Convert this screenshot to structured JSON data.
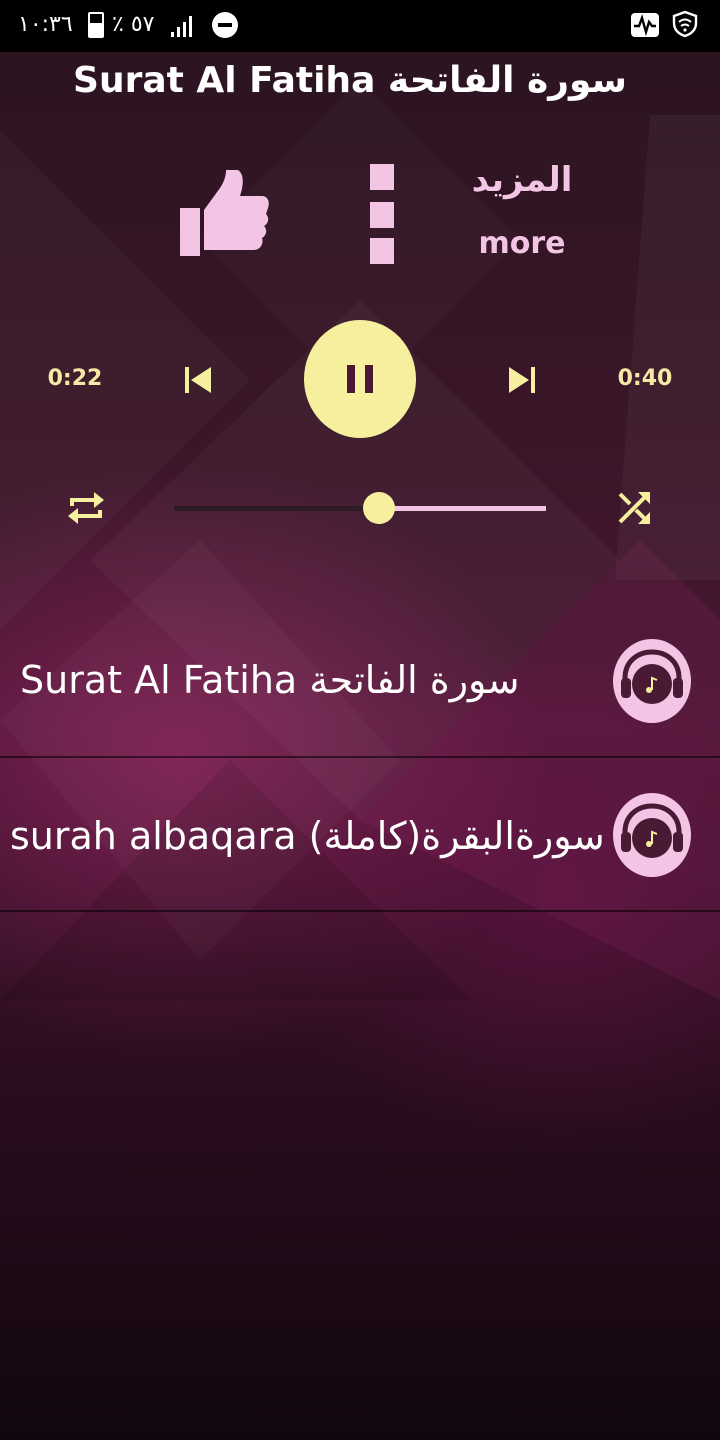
{
  "status_bar": {
    "time": "١٠:٣٦",
    "battery_percent": "٪ ٥٧",
    "battery_level": 0.57,
    "icons": [
      "battery-icon",
      "signal-icon",
      "do-not-disturb-icon",
      "activity-icon",
      "shield-icon"
    ]
  },
  "header": {
    "title": "Surat Al Fatiha سورة الفاتحة",
    "more_label_ar": "المزيد",
    "more_label_en": "more",
    "icons": [
      "thumbs-up-icon",
      "more-vertical-icon"
    ]
  },
  "player": {
    "elapsed": "0:22",
    "duration": "0:40",
    "progress": 0.55,
    "state": "playing",
    "icons": [
      "previous-icon",
      "pause-icon",
      "next-icon",
      "repeat-icon",
      "shuffle-icon"
    ]
  },
  "tracks": [
    {
      "title": "Surat Al Fatiha سورة الفاتحة",
      "icon": "headphones-music-icon"
    },
    {
      "title": "surah albaqara (سورةالبقرة(كاملة",
      "icon": "headphones-music-icon"
    }
  ],
  "colors": {
    "accent_yellow": "#f6ef9e",
    "accent_pink": "#f3c4e4",
    "time_text": "#f6e9a6",
    "background_dark": "#1d0d17",
    "background_magenta": "#4a1734"
  }
}
